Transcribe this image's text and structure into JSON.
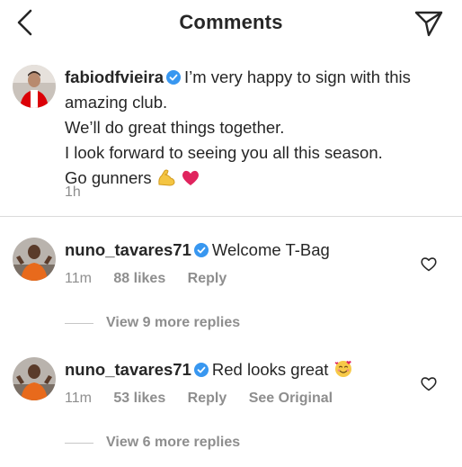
{
  "header": {
    "title": "Comments",
    "back_icon": "chevron-left-icon",
    "send_icon": "paper-plane-icon"
  },
  "post": {
    "username": "fabiodfvieira",
    "verified": true,
    "caption_lines": [
      "I’m very happy to sign with this",
      "amazing club.",
      "We’ll do great things together.",
      "I look forward to seeing you all this season.",
      "Go gunners"
    ],
    "caption_emojis": [
      "flexed-biceps-emoji",
      "red-heart-emoji"
    ],
    "time": "1h"
  },
  "comments": [
    {
      "username": "nuno_tavares71",
      "verified": true,
      "text": "Welcome T-Bag",
      "time": "11m",
      "likes": "88 likes",
      "reply_label": "Reply",
      "see_original": "",
      "view_more": "View 9 more replies"
    },
    {
      "username": "nuno_tavares71",
      "verified": true,
      "text": "Red looks great",
      "emoji": "smiling-face-with-hearts-emoji",
      "time": "11m",
      "likes": "53 likes",
      "reply_label": "Reply",
      "see_original": "See Original",
      "view_more": "View 6 more replies"
    }
  ],
  "colors": {
    "text": "#262626",
    "secondary": "#8e8e8e",
    "verified": "#3897f0",
    "divider": "#dbdbdb",
    "heart_emoji": "#e0245e",
    "arsenal_red": "#db0007"
  }
}
